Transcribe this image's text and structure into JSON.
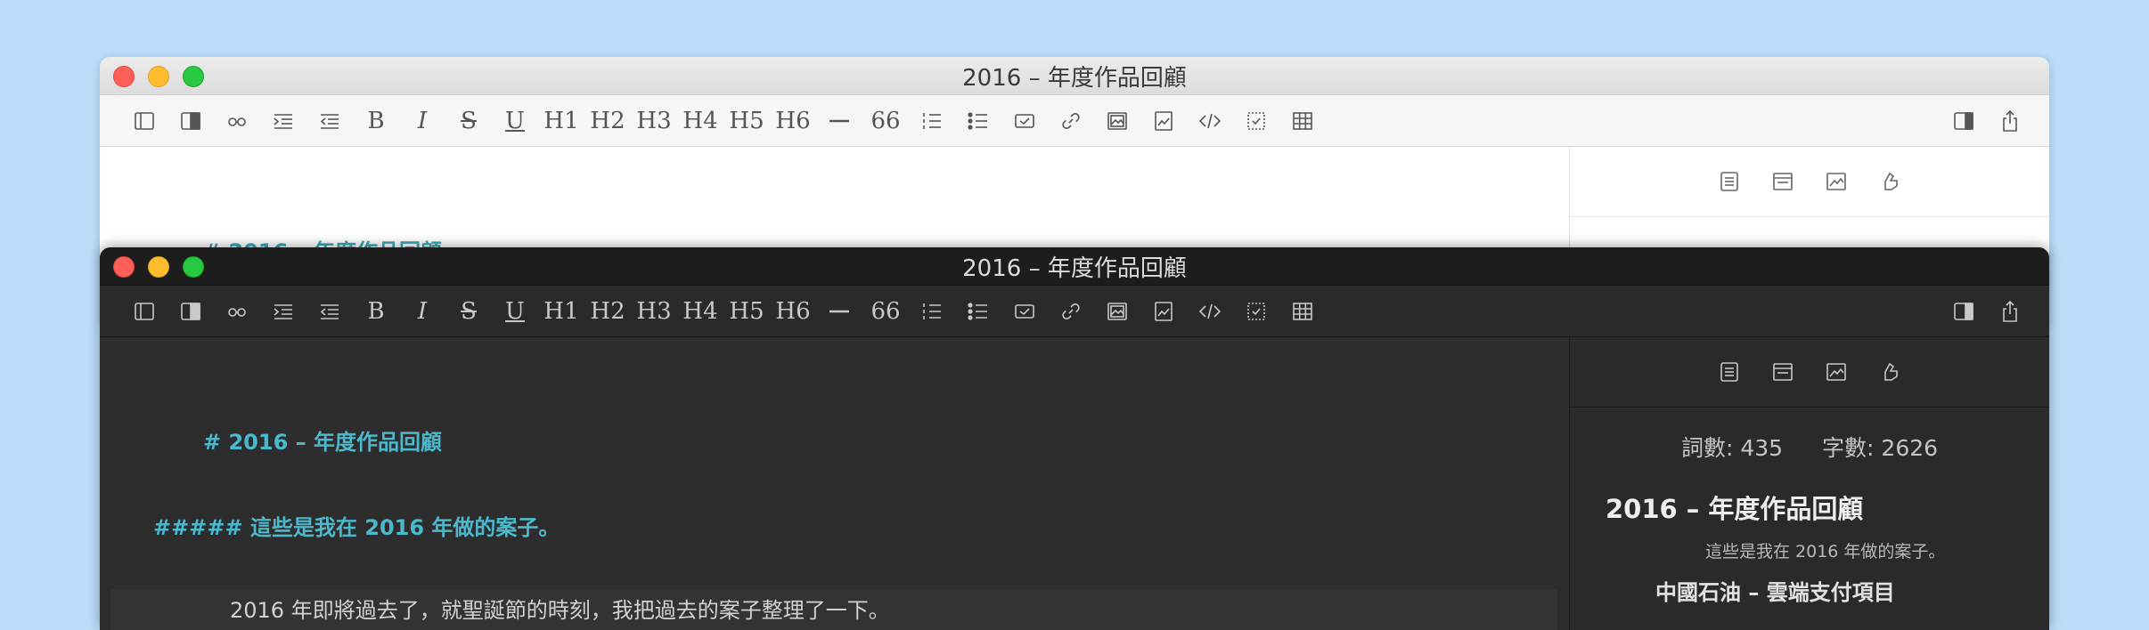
{
  "document_title": "2016 – 年度作品回顧",
  "toolbar": {
    "headings": [
      "H1",
      "H2",
      "H3",
      "H4",
      "H5",
      "H6"
    ],
    "quote_label": "66"
  },
  "editor": {
    "h1_line": "# 2016 – 年度作品回顧",
    "h5_line": "##### 這些是我在 2016 年做的案子。",
    "paragraph": "2016 年即將過去了，就聖誕節的時刻，我把過去的案子整理了一下。"
  },
  "sidebar": {
    "word_count_label": "詞數: 435",
    "char_count_label": "字數: 2626",
    "outline": {
      "h1": "2016 – 年度作品回顧",
      "h5": "這些是我在 2016 年做的案子。",
      "h2": "中國石油 – 雲端支付項目"
    }
  },
  "colors": {
    "background": "#bcdcfa",
    "markdown_heading": "#4cb8cc",
    "close": "#fe5f57",
    "minimize": "#febc2e",
    "zoom": "#28c840"
  }
}
